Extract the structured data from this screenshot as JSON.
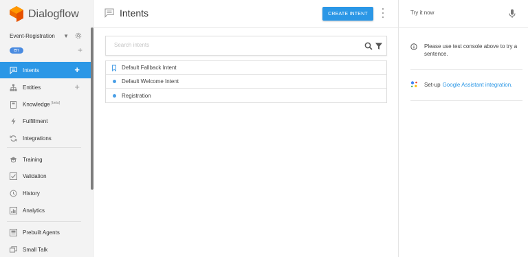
{
  "brand": {
    "name": "Dialogflow",
    "accent": "#2b97e6",
    "logo_color": "#ef6c00"
  },
  "agent": {
    "name": "Event-Registration",
    "language": "en"
  },
  "nav": {
    "items": [
      {
        "label": "Intents",
        "icon": "chat-bubble-icon",
        "active": true,
        "has_add": true
      },
      {
        "label": "Entities",
        "icon": "hierarchy-icon",
        "active": false,
        "has_add": true
      },
      {
        "label": "Knowledge",
        "badge": "[beta]",
        "icon": "book-icon",
        "active": false
      },
      {
        "label": "Fulfillment",
        "icon": "lightning-icon",
        "active": false
      },
      {
        "label": "Integrations",
        "icon": "refresh-icon",
        "active": false
      },
      {
        "label": "Training",
        "icon": "graduation-cap-icon",
        "active": false
      },
      {
        "label": "Validation",
        "icon": "checkbox-icon",
        "active": false
      },
      {
        "label": "History",
        "icon": "clock-icon",
        "active": false
      },
      {
        "label": "Analytics",
        "icon": "bar-chart-icon",
        "active": false
      },
      {
        "label": "Prebuilt Agents",
        "icon": "agent-icon",
        "active": false
      },
      {
        "label": "Small Talk",
        "icon": "chat-stack-icon",
        "active": false
      }
    ]
  },
  "main": {
    "title": "Intents",
    "create_button": "CREATE INTENT",
    "search": {
      "placeholder": "Search intents"
    },
    "intents": [
      {
        "name": "Default Fallback Intent",
        "marker": "bookmark-icon"
      },
      {
        "name": "Default Welcome Intent",
        "marker": "dot"
      },
      {
        "name": "Registration",
        "marker": "dot"
      }
    ]
  },
  "console": {
    "placeholder": "Try it now",
    "info": "Please use test console above to try a sentence.",
    "ga_prefix": "Set-up",
    "ga_link": "Google Assistant integration."
  }
}
